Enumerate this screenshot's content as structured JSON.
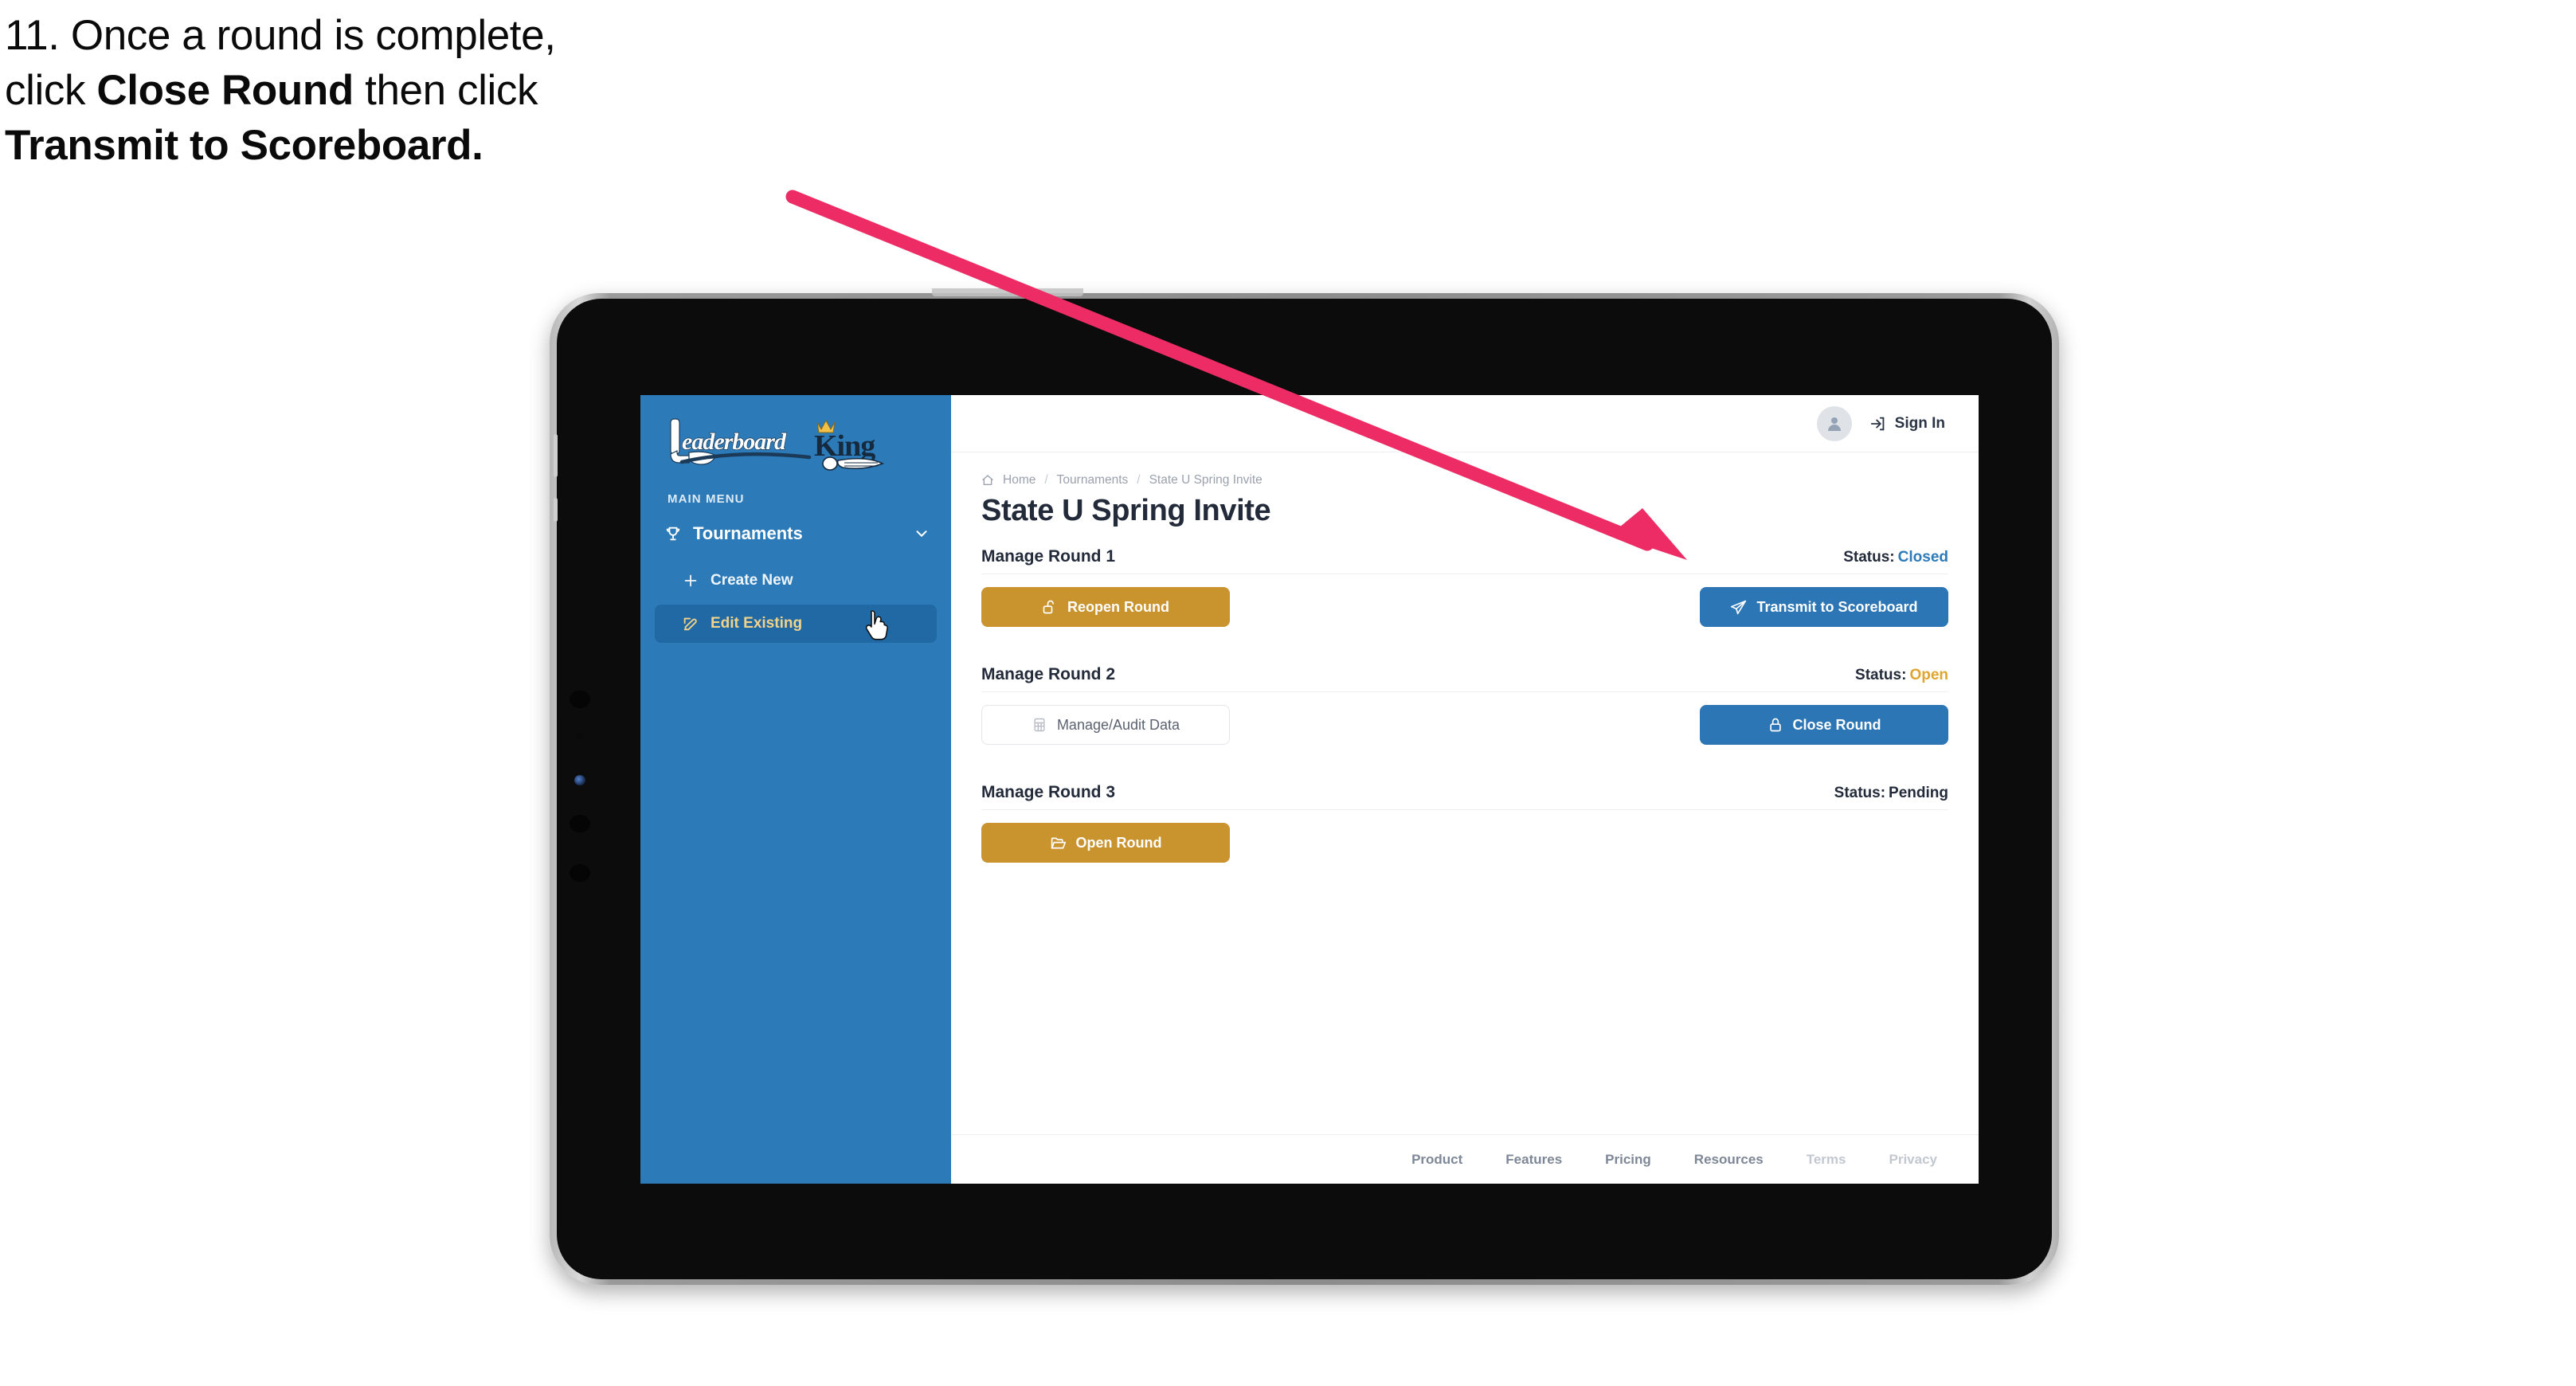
{
  "caption": {
    "line1": "11. Once a round is complete,",
    "line2_pre": "click ",
    "line2_bold": "Close Round",
    "line2_post": " then click",
    "line3_bold": "Transmit to Scoreboard."
  },
  "colors": {
    "sidebar_blue": "#2C7AB8",
    "button_blue": "#2C76B5",
    "button_gold": "#C9932E",
    "status_open_gold": "#E0A52E",
    "status_closed_blue": "#2C7AB8",
    "annotation_pink": "#ED2C66",
    "active_nav_bg": "#2069A4",
    "active_nav_text": "#F2D38A"
  },
  "sidebar": {
    "logo_text_primary": "Leaderboard",
    "logo_text_secondary": "King",
    "menu_label": "MAIN MENU",
    "nav": {
      "group_label": "Tournaments",
      "group_icon": "trophy-icon",
      "chevron_icon": "chevron-down-icon",
      "items": [
        {
          "label": "Create New",
          "icon": "plus-icon",
          "active": false
        },
        {
          "label": "Edit Existing",
          "icon": "edit-pencil-icon",
          "active": true
        }
      ]
    }
  },
  "topbar": {
    "avatar_icon": "user-avatar-icon",
    "signin_icon": "login-arrow-icon",
    "signin_label": "Sign In"
  },
  "breadcrumb": {
    "home_icon": "home-icon",
    "items": [
      "Home",
      "Tournaments",
      "State U Spring Invite"
    ],
    "separator": "/"
  },
  "page": {
    "title": "State U Spring Invite"
  },
  "rounds": [
    {
      "name": "Manage Round 1",
      "status_label": "Status:",
      "status_value": "Closed",
      "status_style": "st-closed",
      "left_button": {
        "label": "Reopen Round",
        "icon": "unlock-icon",
        "style": "btn-gold"
      },
      "right_button": {
        "label": "Transmit to Scoreboard",
        "icon": "paper-plane-icon",
        "style": "btn-blue"
      }
    },
    {
      "name": "Manage Round 2",
      "status_label": "Status:",
      "status_value": "Open",
      "status_style": "st-open",
      "left_button": {
        "label": "Manage/Audit Data",
        "icon": "grid-table-icon",
        "style": "btn-ghost"
      },
      "right_button": {
        "label": "Close Round",
        "icon": "lock-icon",
        "style": "btn-blue"
      }
    },
    {
      "name": "Manage Round 3",
      "status_label": "Status:",
      "status_value": "Pending",
      "status_style": "st-pending",
      "left_button": {
        "label": "Open Round",
        "icon": "open-folder-icon",
        "style": "btn-gold"
      },
      "right_button": null
    }
  ],
  "footer": {
    "links": [
      {
        "label": "Product",
        "dim": false
      },
      {
        "label": "Features",
        "dim": false
      },
      {
        "label": "Pricing",
        "dim": false
      },
      {
        "label": "Resources",
        "dim": false
      },
      {
        "label": "Terms",
        "dim": true
      },
      {
        "label": "Privacy",
        "dim": true
      }
    ]
  },
  "annotation": {
    "type": "arrow",
    "points_to": "Transmit to Scoreboard button"
  },
  "cursor": {
    "icon": "pointing-hand-cursor",
    "over": "Edit Existing"
  }
}
